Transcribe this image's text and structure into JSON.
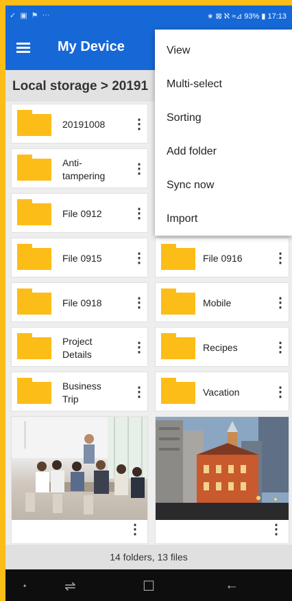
{
  "status_bar": {
    "left_icons": [
      "check-icon",
      "gallery-icon",
      "flag-icon",
      "more-icon"
    ],
    "left_glyphs": [
      "✓",
      "▣",
      "⚑",
      "···"
    ],
    "right_text": "∗ ⊠ ℵ ≈⊿ 93% ▮ 17:13"
  },
  "app_bar": {
    "title": "My Device"
  },
  "breadcrumb": {
    "text": "Local storage > 20191"
  },
  "folders": [
    {
      "name": "20191008"
    },
    {
      "name": "Anti-\ntampering"
    },
    {
      "name": "File 0912"
    },
    {
      "name": "File 0915"
    },
    {
      "name": "File 0916"
    },
    {
      "name": "File 0918"
    },
    {
      "name": "Mobile"
    },
    {
      "name": "Project\nDetails"
    },
    {
      "name": "Recipes"
    },
    {
      "name": "Business\nTrip"
    },
    {
      "name": "Vacation"
    }
  ],
  "more_glyph": "⋮",
  "overflow_menu": {
    "items": [
      "View",
      "Multi-select",
      "Sorting",
      "Add folder",
      "Sync now",
      "Import"
    ]
  },
  "footer": {
    "summary": "14 folders, 13 files"
  },
  "nav_bar": {
    "recents_glyph": "⇌",
    "home_glyph": "☐",
    "back_glyph": "←",
    "dot_glyph": "•"
  },
  "colors": {
    "accent": "#1768d7",
    "folder": "#fdbd19",
    "frame": "#fdbd19"
  }
}
